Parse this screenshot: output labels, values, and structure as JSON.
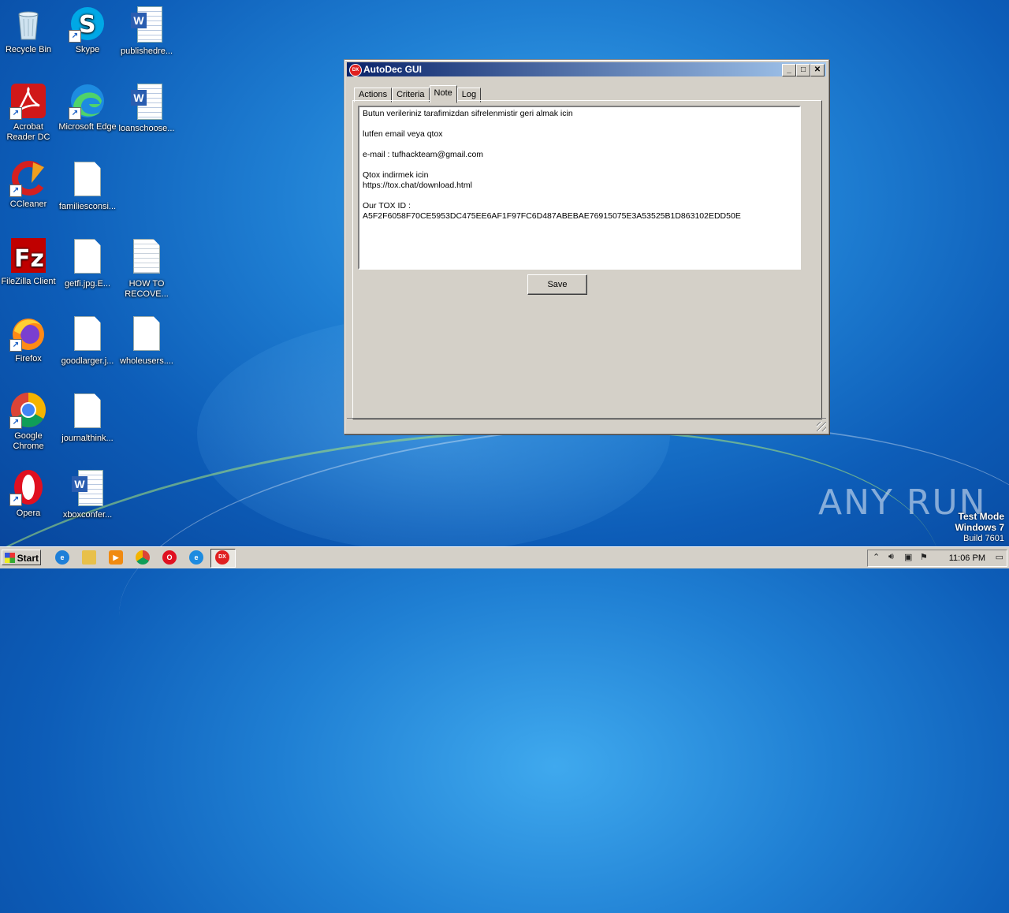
{
  "desktop": {
    "icons": [
      {
        "label": "Recycle Bin",
        "icon": "recycle-bin-icon"
      },
      {
        "label": "Skype",
        "icon": "skype-icon"
      },
      {
        "label": "publishedre...",
        "icon": "word-doc-icon"
      },
      {
        "label": "Acrobat Reader DC",
        "icon": "acrobat-icon"
      },
      {
        "label": "Microsoft Edge",
        "icon": "edge-icon"
      },
      {
        "label": "loanschoose...",
        "icon": "word-doc-icon"
      },
      {
        "label": "CCleaner",
        "icon": "ccleaner-icon"
      },
      {
        "label": "familiesconsi...",
        "icon": "blank-file-icon"
      },
      {
        "label": "FileZilla Client",
        "icon": "filezilla-icon"
      },
      {
        "label": "getfi.jpg.E...",
        "icon": "blank-file-icon"
      },
      {
        "label": "HOW TO RECOVE...",
        "icon": "text-file-icon"
      },
      {
        "label": "Firefox",
        "icon": "firefox-icon"
      },
      {
        "label": "goodlarger.j...",
        "icon": "blank-file-icon"
      },
      {
        "label": "wholeusers....",
        "icon": "blank-file-icon"
      },
      {
        "label": "Google Chrome",
        "icon": "chrome-icon"
      },
      {
        "label": "journalthink...",
        "icon": "blank-file-icon"
      },
      {
        "label": "Opera",
        "icon": "opera-icon"
      },
      {
        "label": "xboxconfer...",
        "icon": "word-doc-icon"
      }
    ]
  },
  "window": {
    "title": "AutoDec GUI",
    "app_icon_text": "DX",
    "controls": {
      "minimize": "_",
      "maximize": "□",
      "close": "✕"
    },
    "tabs": [
      {
        "label": "Actions",
        "active": false
      },
      {
        "label": "Criteria",
        "active": false
      },
      {
        "label": "Note",
        "active": true
      },
      {
        "label": "Log",
        "active": false
      }
    ],
    "note_lines": [
      "Butun verileriniz tarafimizdan sifrelenmistir geri almak icin",
      "",
      "lutfen email veya qtox",
      "",
      "e-mail : tufhackteam@gmail.com",
      "",
      "Qtox indirmek icin",
      "https://tox.chat/download.html",
      "",
      "Our TOX ID :",
      "A5F2F6058F70CE5953DC475EE6AF1F97FC6D487ABEBAE76915075E3A53525B1D863102EDD50E"
    ],
    "save_label": "Save"
  },
  "watermark": {
    "brand": "ANY RUN",
    "test_mode": "Test Mode",
    "os": "Windows 7",
    "build": "Build 7601"
  },
  "taskbar": {
    "start_label": "Start",
    "apps": [
      "ie-icon",
      "explorer-icon",
      "media-player-icon",
      "chrome-icon",
      "opera-icon",
      "edge-icon",
      "autodec-icon"
    ],
    "clock": "11:06 PM",
    "accent": "#0a246a"
  }
}
